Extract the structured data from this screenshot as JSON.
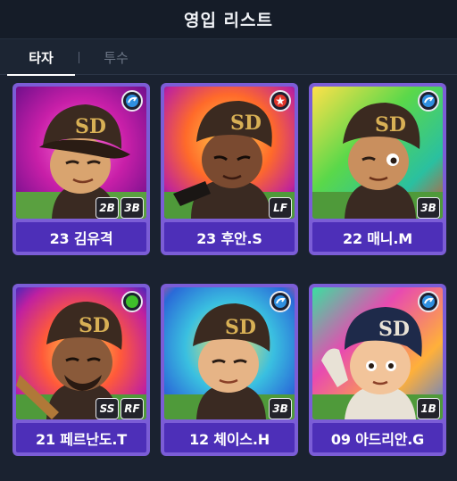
{
  "header": {
    "title": "영입 리스트"
  },
  "tabs": [
    {
      "label": "타자",
      "active": true
    },
    {
      "label": "투수",
      "active": false
    }
  ],
  "colors": {
    "card_frame": "#7b5dd6",
    "name_bar": "#4d2fb8",
    "badge_blue": "#2f8fe0",
    "badge_red": "#e0342a",
    "badge_green": "#3fbf2a"
  },
  "players": [
    {
      "name": "23 김유격",
      "positions": [
        "2B",
        "3B"
      ],
      "badge": "blue-arrow-icon"
    },
    {
      "name": "23 후안.S",
      "positions": [
        "LF"
      ],
      "badge": "red-star-icon"
    },
    {
      "name": "22 매니.M",
      "positions": [
        "3B"
      ],
      "badge": "blue-arrow-icon"
    },
    {
      "name": "21 페르난도.T",
      "positions": [
        "SS",
        "RF"
      ],
      "badge": "green-dot-icon"
    },
    {
      "name": "12 체이스.H",
      "positions": [
        "3B"
      ],
      "badge": "blue-arrow-icon"
    },
    {
      "name": "09 아드리안.G",
      "positions": [
        "1B"
      ],
      "badge": "blue-arrow-icon"
    }
  ]
}
